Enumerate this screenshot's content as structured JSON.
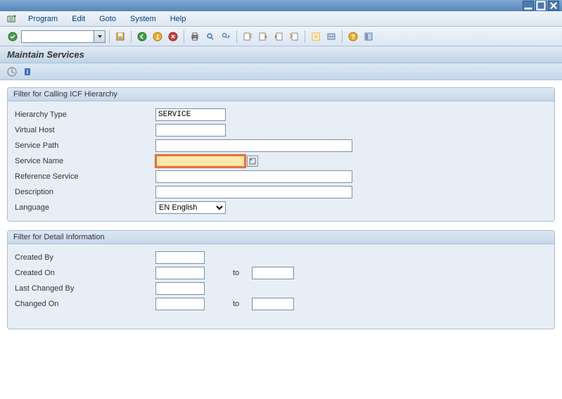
{
  "window": {
    "title": "Maintain Services"
  },
  "menu": {
    "program": "Program",
    "edit": "Edit",
    "goto": "Goto",
    "system": "System",
    "help": "Help"
  },
  "groupbox1": {
    "title": "Filter for Calling ICF Hierarchy",
    "hierarchy_type_label": "Hierarchy Type",
    "hierarchy_type_value": "SERVICE",
    "virtual_host_label": "Virtual Host",
    "virtual_host_value": "",
    "service_path_label": "Service Path",
    "service_path_value": "",
    "service_name_label": "Service Name",
    "service_name_value": "",
    "reference_service_label": "Reference Service",
    "reference_service_value": "",
    "description_label": "Description",
    "description_value": "",
    "language_label": "Language",
    "language_value": "EN English"
  },
  "groupbox2": {
    "title": "Filter for Detail Information",
    "created_by_label": "Created By",
    "created_by_value": "",
    "created_on_label": "Created On",
    "created_on_value": "",
    "created_on_to_value": "",
    "last_changed_by_label": "Last Changed By",
    "last_changed_by_value": "",
    "changed_on_label": "Changed On",
    "changed_on_value": "",
    "changed_on_to_value": "",
    "to_label": "to"
  }
}
